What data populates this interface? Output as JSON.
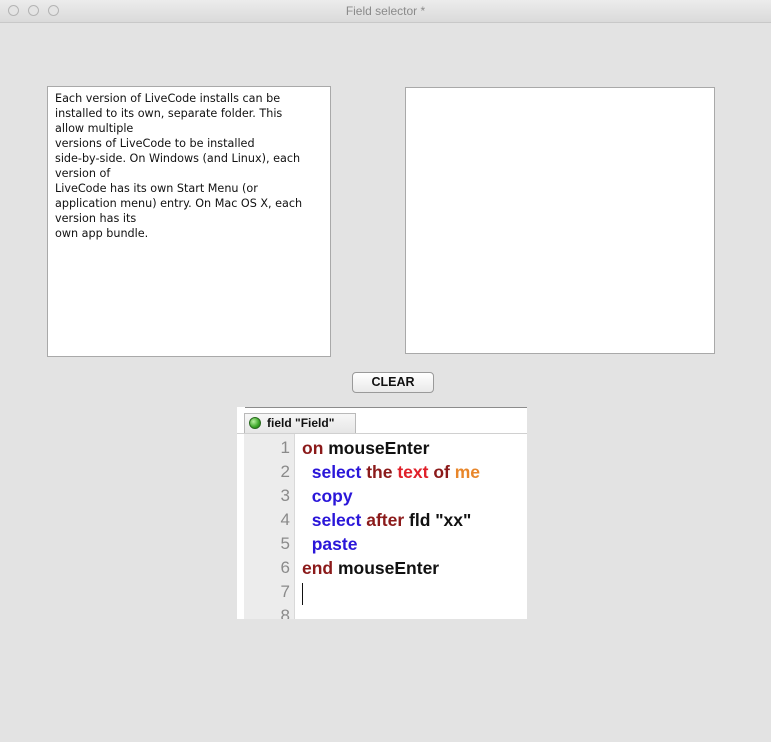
{
  "window": {
    "title": "Field selector *"
  },
  "left_field": {
    "text": "Each version of LiveCode installs can be\ninstalled to its own, separate folder. This\nallow multiple\nversions of LiveCode to be installed\nside-by-side. On Windows (and Linux), each\nversion of\nLiveCode has its own Start Menu (or\napplication menu) entry. On Mac OS X, each\nversion has its\nown app bundle."
  },
  "clear_button": {
    "label": "CLEAR"
  },
  "editor": {
    "tab_label": "field \"Field\"",
    "line_numbers": [
      "1",
      "2",
      "3",
      "4",
      "5",
      "6",
      "7",
      "8"
    ],
    "lines": [
      [
        {
          "t": "on ",
          "c": "kw-dark"
        },
        {
          "t": "mouseEnter",
          "c": "plain"
        }
      ],
      [
        {
          "t": "  select ",
          "c": "kw-blue"
        },
        {
          "t": "the ",
          "c": "kw-dark"
        },
        {
          "t": "text ",
          "c": "kw-red"
        },
        {
          "t": "of ",
          "c": "kw-dark"
        },
        {
          "t": "me",
          "c": "kw-orange"
        }
      ],
      [
        {
          "t": "  copy",
          "c": "kw-blue"
        }
      ],
      [
        {
          "t": "  select ",
          "c": "kw-blue"
        },
        {
          "t": "after ",
          "c": "kw-dark"
        },
        {
          "t": "fld \"xx\"",
          "c": "plain"
        }
      ],
      [
        {
          "t": "  paste",
          "c": "kw-blue"
        }
      ],
      [
        {
          "t": "end ",
          "c": "kw-dark"
        },
        {
          "t": "mouseEnter",
          "c": "plain"
        }
      ],
      [],
      []
    ]
  }
}
